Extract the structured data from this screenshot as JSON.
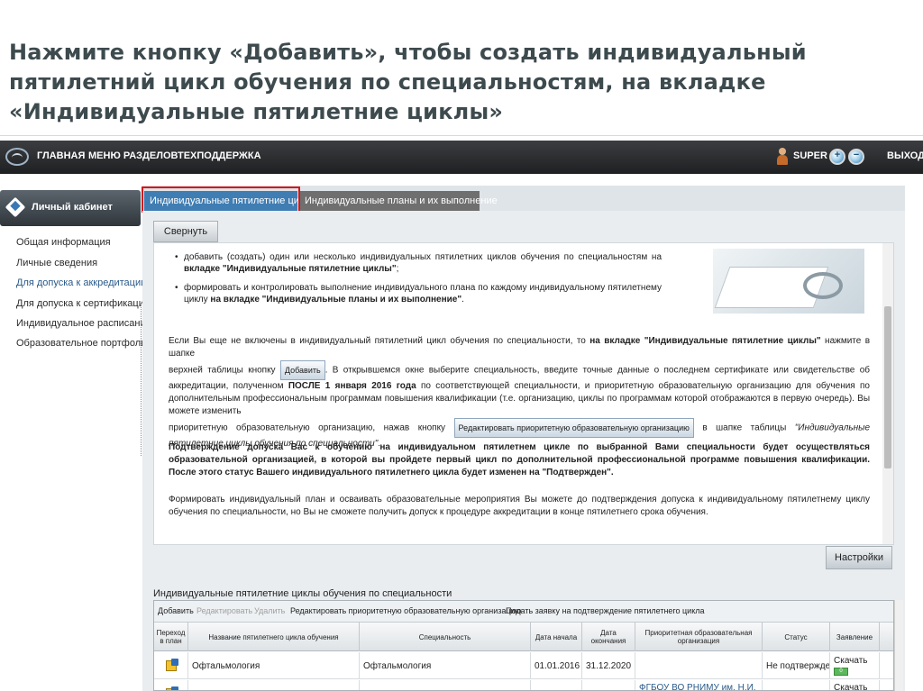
{
  "slide": {
    "title_lines": [
      "Нажмите кнопку «Добавить», чтобы создать индивидуальный",
      "пятилетний цикл обучения по специальностям, на вкладке",
      "«Индивидуальные пятилетние циклы»"
    ]
  },
  "topbar": {
    "nav": [
      "ГЛАВНАЯ",
      "МЕНЮ РАЗДЕЛОВ",
      "ТЕХПОДДЕРЖКА"
    ],
    "user": "SUPER",
    "logout": "ВЫХОД",
    "zoom_in": "+",
    "zoom_out": "−"
  },
  "sidebar": {
    "header": "Личный кабинет",
    "items": [
      "Общая информация",
      "Личные сведения",
      "Для допуска к аккредитации",
      "Для допуска к сертификации",
      "Индивидуальное расписание",
      "Образовательное портфолио"
    ]
  },
  "tabs": [
    "Индивидуальные пятилетние циклы",
    "Индивидуальные планы и их выполнение"
  ],
  "buttons": {
    "collapse": "Свернуть",
    "settings": "Настройки"
  },
  "info": {
    "b1_a": "добавить (создать) один или несколько индивидуальных пятилетних циклов обучения по специальностям на",
    "b1_b": "вкладке \"Индивидуальные пятилетние циклы\"",
    "b1_c": ";",
    "b2_a": "формировать и контролировать выполнение индивидуального плана по каждому индивидуальному пятилетнему циклу",
    "b2_b": "на вкладке \"Индивидуальные планы и их выполнение\"",
    "b2_c": ".",
    "p1_a": "Если Вы еще не включены в индивидуальный пятилетний цикл обучения по специальности, то",
    "p1_b": "на вкладке \"Индивидуальные пятилетние циклы\"",
    "p1_c": "нажмите в шапке",
    "p1_d": "верхней таблицы кнопку",
    "p1_btn": "Добавить",
    "p1_e": ". В открывшемся окне выберите специальность, введите точные данные о последнем сертификате или свидетельстве об аккредитации, полученном",
    "p1_f": "ПОСЛЕ 1 января 2016 года",
    "p1_g": "по соответствующей специальности, и приоритетную образовательную организацию для обучения по дополнительным профессиональным программам повышения квалификации (т.е. организацию, циклы по программам которой отображаются в первую очередь). Вы можете изменить",
    "p1_h": "приоритетную образовательную организацию, нажав кнопку",
    "p1_btn2": "Редактировать приоритетную образовательную организацию",
    "p1_i": "в шапке таблицы",
    "p1_j": "\"Индивидуальные пятилетние циклы обучения по специальности\"",
    "p1_k": ".",
    "p2": "Подтверждение допуска Вас к обучению на индивидуальном пятилетнем цикле по выбранной Вами специальности будет осуществляться образовательной организацией, в которой вы пройдете первый цикл по дополнительной профессиональной программе повышения квалификации. После этого статус Вашего индивидуального пятилетнего цикла будет изменен на \"Подтвержден\".",
    "p3": "Формировать индивидуальный план и осваивать образовательные мероприятия Вы можете до подтверждения допуска к индивидуальному пятилетнему циклу обучения по специальности, но Вы не сможете получить допуск к процедуре аккредитации в конце пятилетнего срока обучения."
  },
  "grid": {
    "title": "Индивидуальные пятилетние циклы обучения по специальности",
    "toolbar": {
      "add": "Добавить",
      "edit": "Редактировать",
      "delete": "Удалить",
      "edit_org": "Редактировать приоритетную образовательную организацию",
      "submit": "Подать заявку на подтверждение пятилетнего цикла"
    },
    "headers": {
      "goto": "Переход в план",
      "name": "Название пятилетнего цикла обучения",
      "specialty": "Специальность",
      "start": "Дата начала",
      "end": "Дата окончания",
      "org": "Приоритетная образовательная организация",
      "status": "Статус",
      "application": "Заявление"
    },
    "rows": [
      {
        "name": "Офтальмология",
        "specialty": "Офтальмология",
        "start": "01.01.2016",
        "end": "31.12.2020",
        "org": "",
        "status": "Не подтвержден",
        "application": "Скачать",
        "badge": "0"
      },
      {
        "name": "",
        "specialty": "",
        "start": "",
        "end": "",
        "org": "ФГБОУ ВО РНИМУ им. Н.И.",
        "status": "",
        "application": "Скачать",
        "badge": ""
      }
    ]
  }
}
